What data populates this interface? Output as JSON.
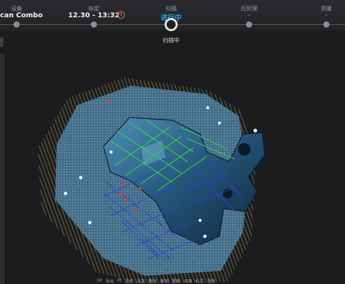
{
  "steps": [
    {
      "title": "设备",
      "value": "eScan Combo",
      "state": "done"
    },
    {
      "title": "标定",
      "value": "12.30 - 13:32",
      "state": "done"
    },
    {
      "title": "扫描",
      "value": "进行中",
      "state": "active"
    },
    {
      "title": "后处理",
      "value": "-",
      "state": "pending"
    },
    {
      "title": "测量",
      "value": "-",
      "state": "pending"
    }
  ],
  "calibration_warning_icon": "warning-icon",
  "status_label": "扫描中",
  "viewport": {
    "background_color": "#1b1c1e",
    "pointcloud_color": "#7ea9c4",
    "fringe_color": "#c9b86a",
    "object_color": "#2f6d94",
    "grid_colors": {
      "near": "#33d64a",
      "far": "#2f3ed8"
    }
  },
  "bottom_toolbar": [
    "Fit",
    "导出",
    "Pt",
    "选择",
    "反选",
    "删除",
    "撤销",
    "重做",
    "光源",
    "标志",
    "视图"
  ],
  "colors": {
    "active": "#2fa3f0",
    "warning": "#e36a5a"
  }
}
